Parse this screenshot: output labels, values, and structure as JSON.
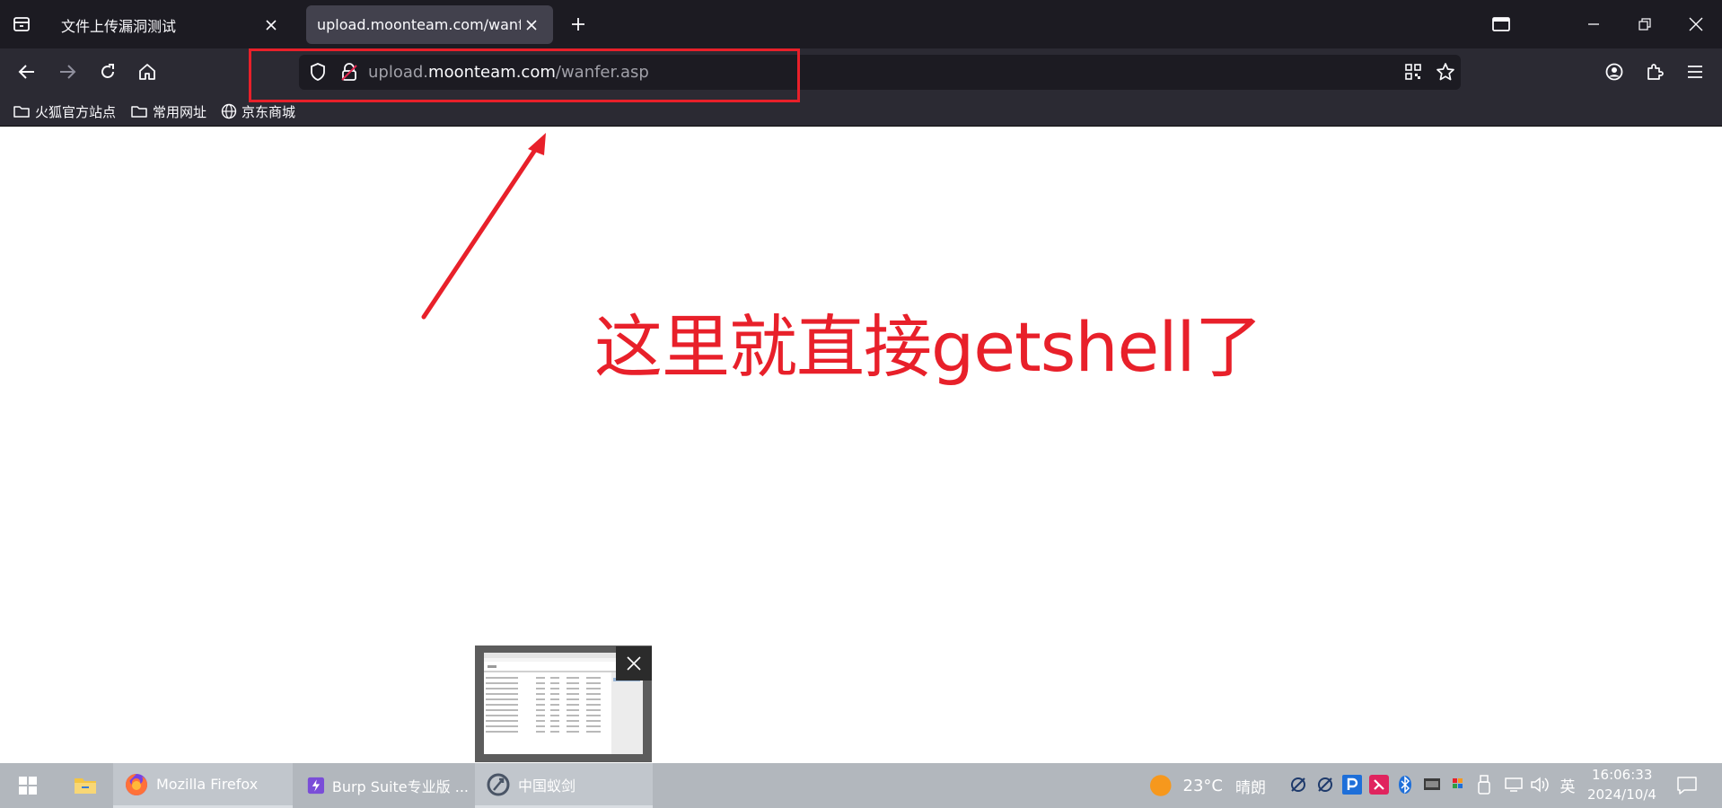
{
  "browser": {
    "tabs": [
      {
        "label": "文件上传漏洞测试",
        "active": false
      },
      {
        "label": "upload.moonteam.com/wanfer.asp",
        "active": true
      }
    ],
    "url": {
      "prefix": "upload.",
      "host": "moonteam.com",
      "path": "/wanfer.asp"
    },
    "bookmarks": [
      {
        "label": "火狐官方站点",
        "icon": "folder-icon"
      },
      {
        "label": "常用网址",
        "icon": "folder-icon"
      },
      {
        "label": "京东商城",
        "icon": "globe-icon"
      }
    ]
  },
  "annotation": {
    "text": "这里就直接getshell了",
    "color": "#e8202a"
  },
  "taskbar": {
    "apps": [
      {
        "label": "Mozilla Firefox",
        "icon": "firefox-icon"
      },
      {
        "label": "Burp Suite专业版 ...",
        "icon": "burp-icon"
      },
      {
        "label": "中国蚁剑",
        "icon": "antsword-icon"
      }
    ],
    "weather": {
      "temp": "23°C",
      "condition": "晴朗"
    },
    "ime": "英",
    "time": "16:06:33",
    "date": "2024/10/4"
  }
}
